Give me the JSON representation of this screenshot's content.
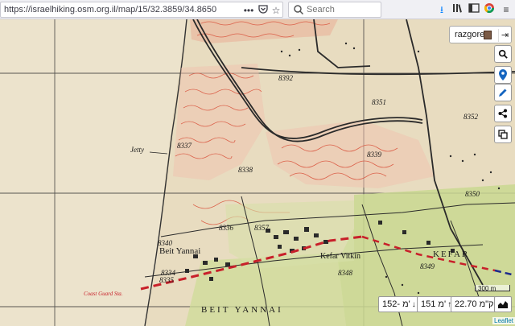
{
  "browser": {
    "url": "https://israelhiking.osm.org.il/map/15/32.3859/34.8650",
    "search_placeholder": "Search"
  },
  "map": {
    "user": {
      "name": "razgoren"
    },
    "labels": {
      "jetty": "Jetty",
      "grid_8392": "8392",
      "grid_8351": "8351",
      "grid_8352": "8352",
      "grid_8337": "8337",
      "grid_8339": "8339",
      "grid_8338": "8338",
      "grid_8350": "8350",
      "grid_8340": "8340",
      "grid_8357": "8357",
      "grid_8336": "8336",
      "grid_8334": "8334",
      "grid_8335": "8335",
      "grid_8348": "8348",
      "grid_8349": "8349",
      "beit_yannai_small": "Beit Yannai",
      "kefar_vitkin": "Kefar Vitkin",
      "kefar_big": "KEFAR",
      "beit_yannai_big": "BEIT YANNAI",
      "coast_guard": "Coast Guard Sta."
    },
    "stats": {
      "distance": "22.70 ק\"מ",
      "ascent": "151 מ'",
      "descent": "152- מ'"
    },
    "scale": "300 m",
    "attribution": "Leaflet"
  },
  "colors": {
    "map_background": "#e8dcc0",
    "contour_red": "#d9503a",
    "route_red": "#c8202a",
    "settlement_green": "#c9d890",
    "road_black": "#2a2a2a"
  }
}
